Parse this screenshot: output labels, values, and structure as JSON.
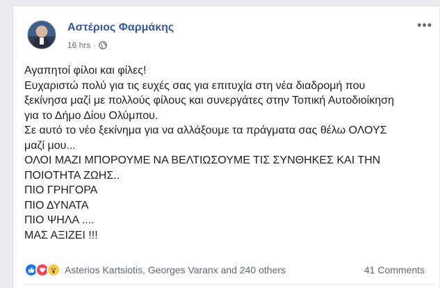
{
  "post": {
    "author": "Αστέριος Φαρμάκης",
    "timestamp": "16 hrs",
    "privacy_icon": "globe-icon",
    "more_icon": "more-options-icon",
    "lines": [
      "Αγαπητοί φίλοι και φίλες!",
      "Ευχαριστώ πολύ για τις ευχές σας για επιτυχία στη νέα διαδρομή που",
      "ξεκίνησα μαζί με πολλούς φίλους και συνεργάτες στην Τοπική Αυτοδιοίκηση",
      "για το Δήμο Δίου Ολύμπου.",
      "Σε αυτό το νέο ξεκίνημα για να αλλάξουμε τα πράγματα σας θέλω ΟΛΟΥΣ",
      "μαζί μου...",
      "ΟΛΟΙ ΜΑΖΙ ΜΠΟΡΟΥΜΕ ΝΑ ΒΕΛΤΙΩΣΟΥΜΕ ΤΙΣ ΣΥΝΘΗΚΕΣ ΚΑΙ ΤΗΝ",
      "ΠΟΙΟΤΗΤΑ ΖΩΗΣ..",
      "ΠΙΟ ΓΡΗΓΟΡΑ",
      "ΠΙΟ ΔΥΝΑΤΑ",
      "ΠΙΟ ΨΗΛΑ ....",
      "ΜΑΣ ΑΞΙΖΕΙ !!!"
    ]
  },
  "footer": {
    "reactions": [
      "like-icon",
      "love-icon",
      "wow-icon"
    ],
    "reaction_names": "Asterios Kartsiotis, Georges Varanx and 240 others",
    "comments": "41 Comments"
  },
  "colors": {
    "author_link": "#365899",
    "like": "#1877f2",
    "love": "#f33e58",
    "wow": "#f7c74a"
  }
}
